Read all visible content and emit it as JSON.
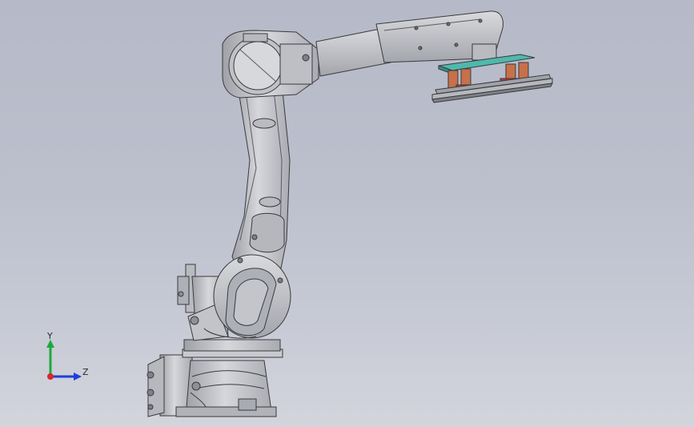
{
  "viewport": {
    "background_top": "#b6bac8",
    "background_bottom": "#d3d5dd"
  },
  "model": {
    "name": "",
    "body_color": "#c7c8cd",
    "edge_color": "#3a3a3c",
    "gripper_plate_color": "#4fb8ad",
    "gripper_cylinder_color": "#c7704a",
    "gripper_accent_color": "#c23a32"
  },
  "triad": {
    "x_axis_label": "Z",
    "y_axis_label": "Y",
    "colors": {
      "x": "#1f3fd8",
      "y": "#1fa83c",
      "origin": "#d8262c"
    }
  }
}
